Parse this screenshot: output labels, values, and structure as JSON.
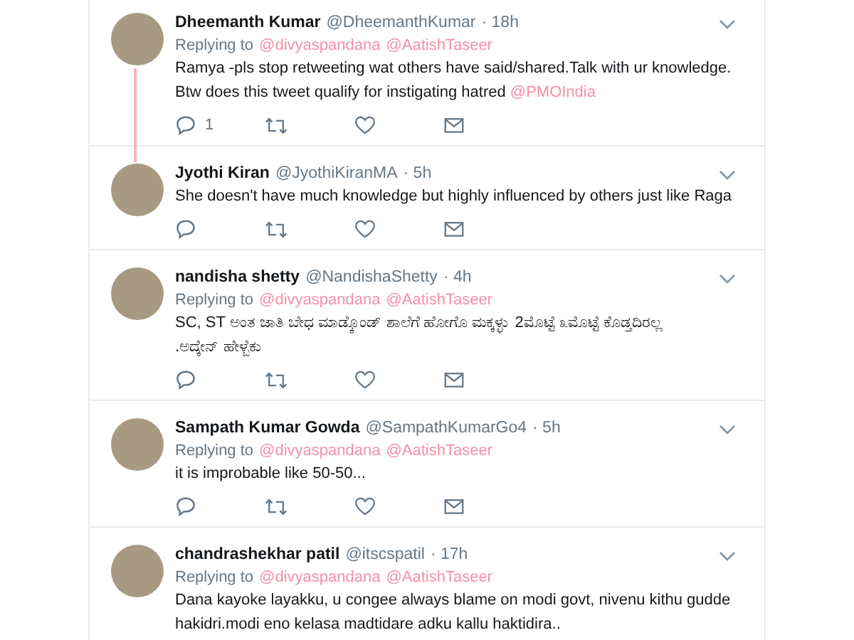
{
  "tweets": [
    {
      "name": "Dheemanth Kumar",
      "handle": "@DheemanthKumar",
      "time": "· 18h",
      "replying_label": "Replying to",
      "replying_to": [
        "@divyaspandana",
        "@AatishTaseer"
      ],
      "lines": [
        [
          {
            "text": "Ramya -pls stop retweeting wat others have said/shared.Talk with ur knowledge.",
            "kind": "plain"
          }
        ],
        [
          {
            "text": "Btw does this tweet qualify for instigating hatred ",
            "kind": "plain"
          },
          {
            "text": "@PMOIndia",
            "kind": "mention"
          }
        ]
      ],
      "reply_count": "1",
      "thread_line": true,
      "actions": true
    },
    {
      "name": "Jyothi Kiran",
      "handle": "@JyothiKiranMA",
      "time": "· 5h",
      "lines": [
        [
          {
            "text": "She doesn't have much knowledge but highly influenced by others just like Raga",
            "kind": "plain"
          }
        ]
      ],
      "thread_line": false,
      "actions": true
    },
    {
      "name": "nandisha shetty",
      "handle": "@NandishaShetty",
      "time": "· 4h",
      "replying_label": "Replying to",
      "replying_to": [
        "@divyaspandana",
        "@AatishTaseer"
      ],
      "lines": [
        [
          {
            "text": "SC, ST ಅಂತ ಜಾತಿ ಬೇಧ ಮಾಡ್ಕೊಂಡ್ ಶಾಲೆಗೆ ಹೋಗೊ ಮಕ್ಕಳ್ಳು 2ಮೊಟ್ಟೆ ೩ಮೊಟ್ಟೆ ಕೊಡ್ತದಿರಲ್ಲ",
            "kind": "plain"
          }
        ],
        [
          {
            "text": ".ಅದ್ಕೇನ್ ಹೇಳ್ಬೆಕು",
            "kind": "plain"
          }
        ]
      ],
      "thread_line": false,
      "actions": true
    },
    {
      "name": "Sampath Kumar Gowda",
      "handle": "@SampathKumarGo4",
      "time": "· 5h",
      "replying_label": "Replying to",
      "replying_to": [
        "@divyaspandana",
        "@AatishTaseer"
      ],
      "lines": [
        [
          {
            "text": "it is improbable like 50-50...",
            "kind": "plain"
          }
        ]
      ],
      "thread_line": false,
      "actions": true
    },
    {
      "name": "chandrashekhar patil",
      "handle": "@itscspatil",
      "time": "· 17h",
      "replying_label": "Replying to",
      "replying_to": [
        "@divyaspandana",
        "@AatishTaseer"
      ],
      "lines": [
        [
          {
            "text": "Dana kayoke layakku, u congee always blame on modi govt, nivenu kithu gudde",
            "kind": "plain"
          }
        ],
        [
          {
            "text": "hakidri.modi eno kelasa madtidare adku kallu haktidira..",
            "kind": "plain"
          }
        ]
      ],
      "thread_line": false,
      "actions": false
    }
  ]
}
